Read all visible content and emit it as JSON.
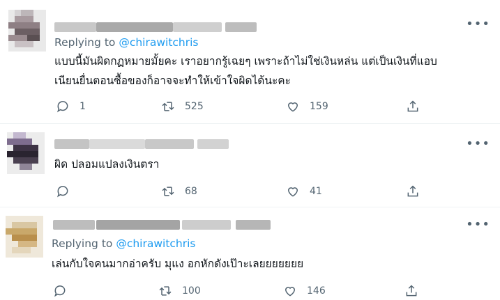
{
  "tweets": [
    {
      "replying_prefix": "Replying to",
      "replying_handle": "@chirawitchris",
      "text_lines": [
        "แบบนี้มันผิดกฏหมายมั้ยคะ เราอยากรู้เฉยๆ เพราะถ้าไม่ใช่เงินหล่น แต่เป็นเงินที่แอบ",
        "เนียนยื่นตอนซื้อของก็อาจจะทำให้เข้าใจผิดได้นะคะ"
      ],
      "replies": "1",
      "retweets": "525",
      "likes": "159"
    },
    {
      "text_lines": [
        "ผิด ปลอมแปลงเงินตรา"
      ],
      "replies": "",
      "retweets": "68",
      "likes": "41"
    },
    {
      "replying_prefix": "Replying to",
      "replying_handle": "@chirawitchris",
      "text_lines": [
        "เล่นกับใจคนมากอ่าครับ มุแง อกหักดังเป๊าะเลยยยยยยย"
      ],
      "replies": "",
      "retweets": "100",
      "likes": "146"
    }
  ],
  "icons": {
    "more": "more-horizontal-icon",
    "reply": "reply-bubble-icon",
    "retweet": "retweet-icon",
    "like": "heart-icon",
    "share": "share-icon"
  },
  "colors": {
    "link": "#1d9bf0",
    "secondary": "#536471",
    "text": "#0f1419"
  }
}
